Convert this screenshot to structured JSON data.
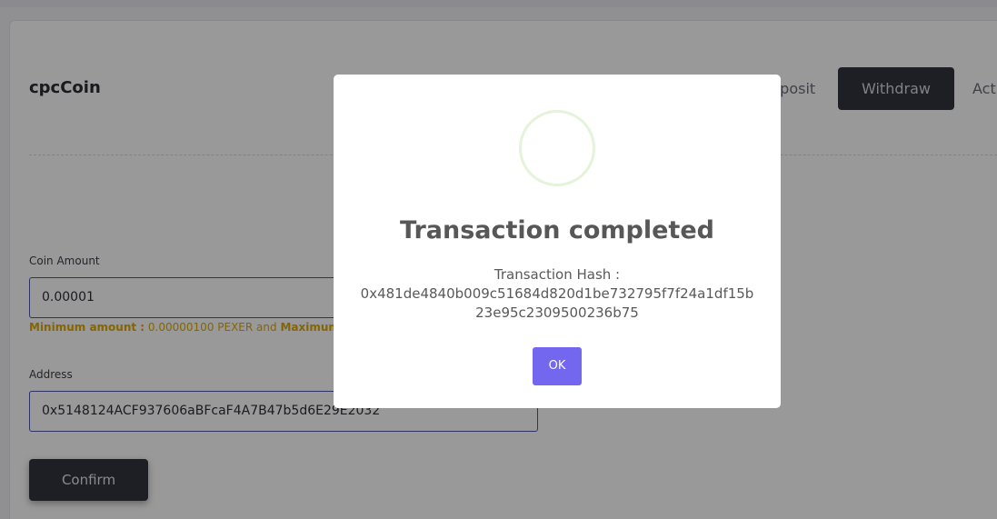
{
  "app": {
    "brand": "cpcCoin"
  },
  "tabs": {
    "deposit": "Deposit",
    "withdraw": "Withdraw",
    "activity": "Activity"
  },
  "form": {
    "amount_label": "Coin Amount",
    "amount_value": "0.00001",
    "hint_min_label": "Minimum amount :",
    "hint_min_value": "0.00000100 PEXER and",
    "hint_max_label": "Maximum",
    "address_label": "Address",
    "address_value": "0x5148124ACF937606aBFcaF4A7B47b5d6E29E2032",
    "confirm_label": "Confirm"
  },
  "modal": {
    "icon": "success-icon",
    "title": "Transaction completed",
    "hash_label": "Transaction Hash :",
    "hash_value": "0x481de4840b009c51684d820d1be732795f7f24a1df15b23e95c2309500236b75",
    "ok_label": "OK"
  },
  "colors": {
    "accent": "#7367f0",
    "dark_button": "#33343d",
    "warning": "#e0a800",
    "input_border": "#4b52a8"
  }
}
